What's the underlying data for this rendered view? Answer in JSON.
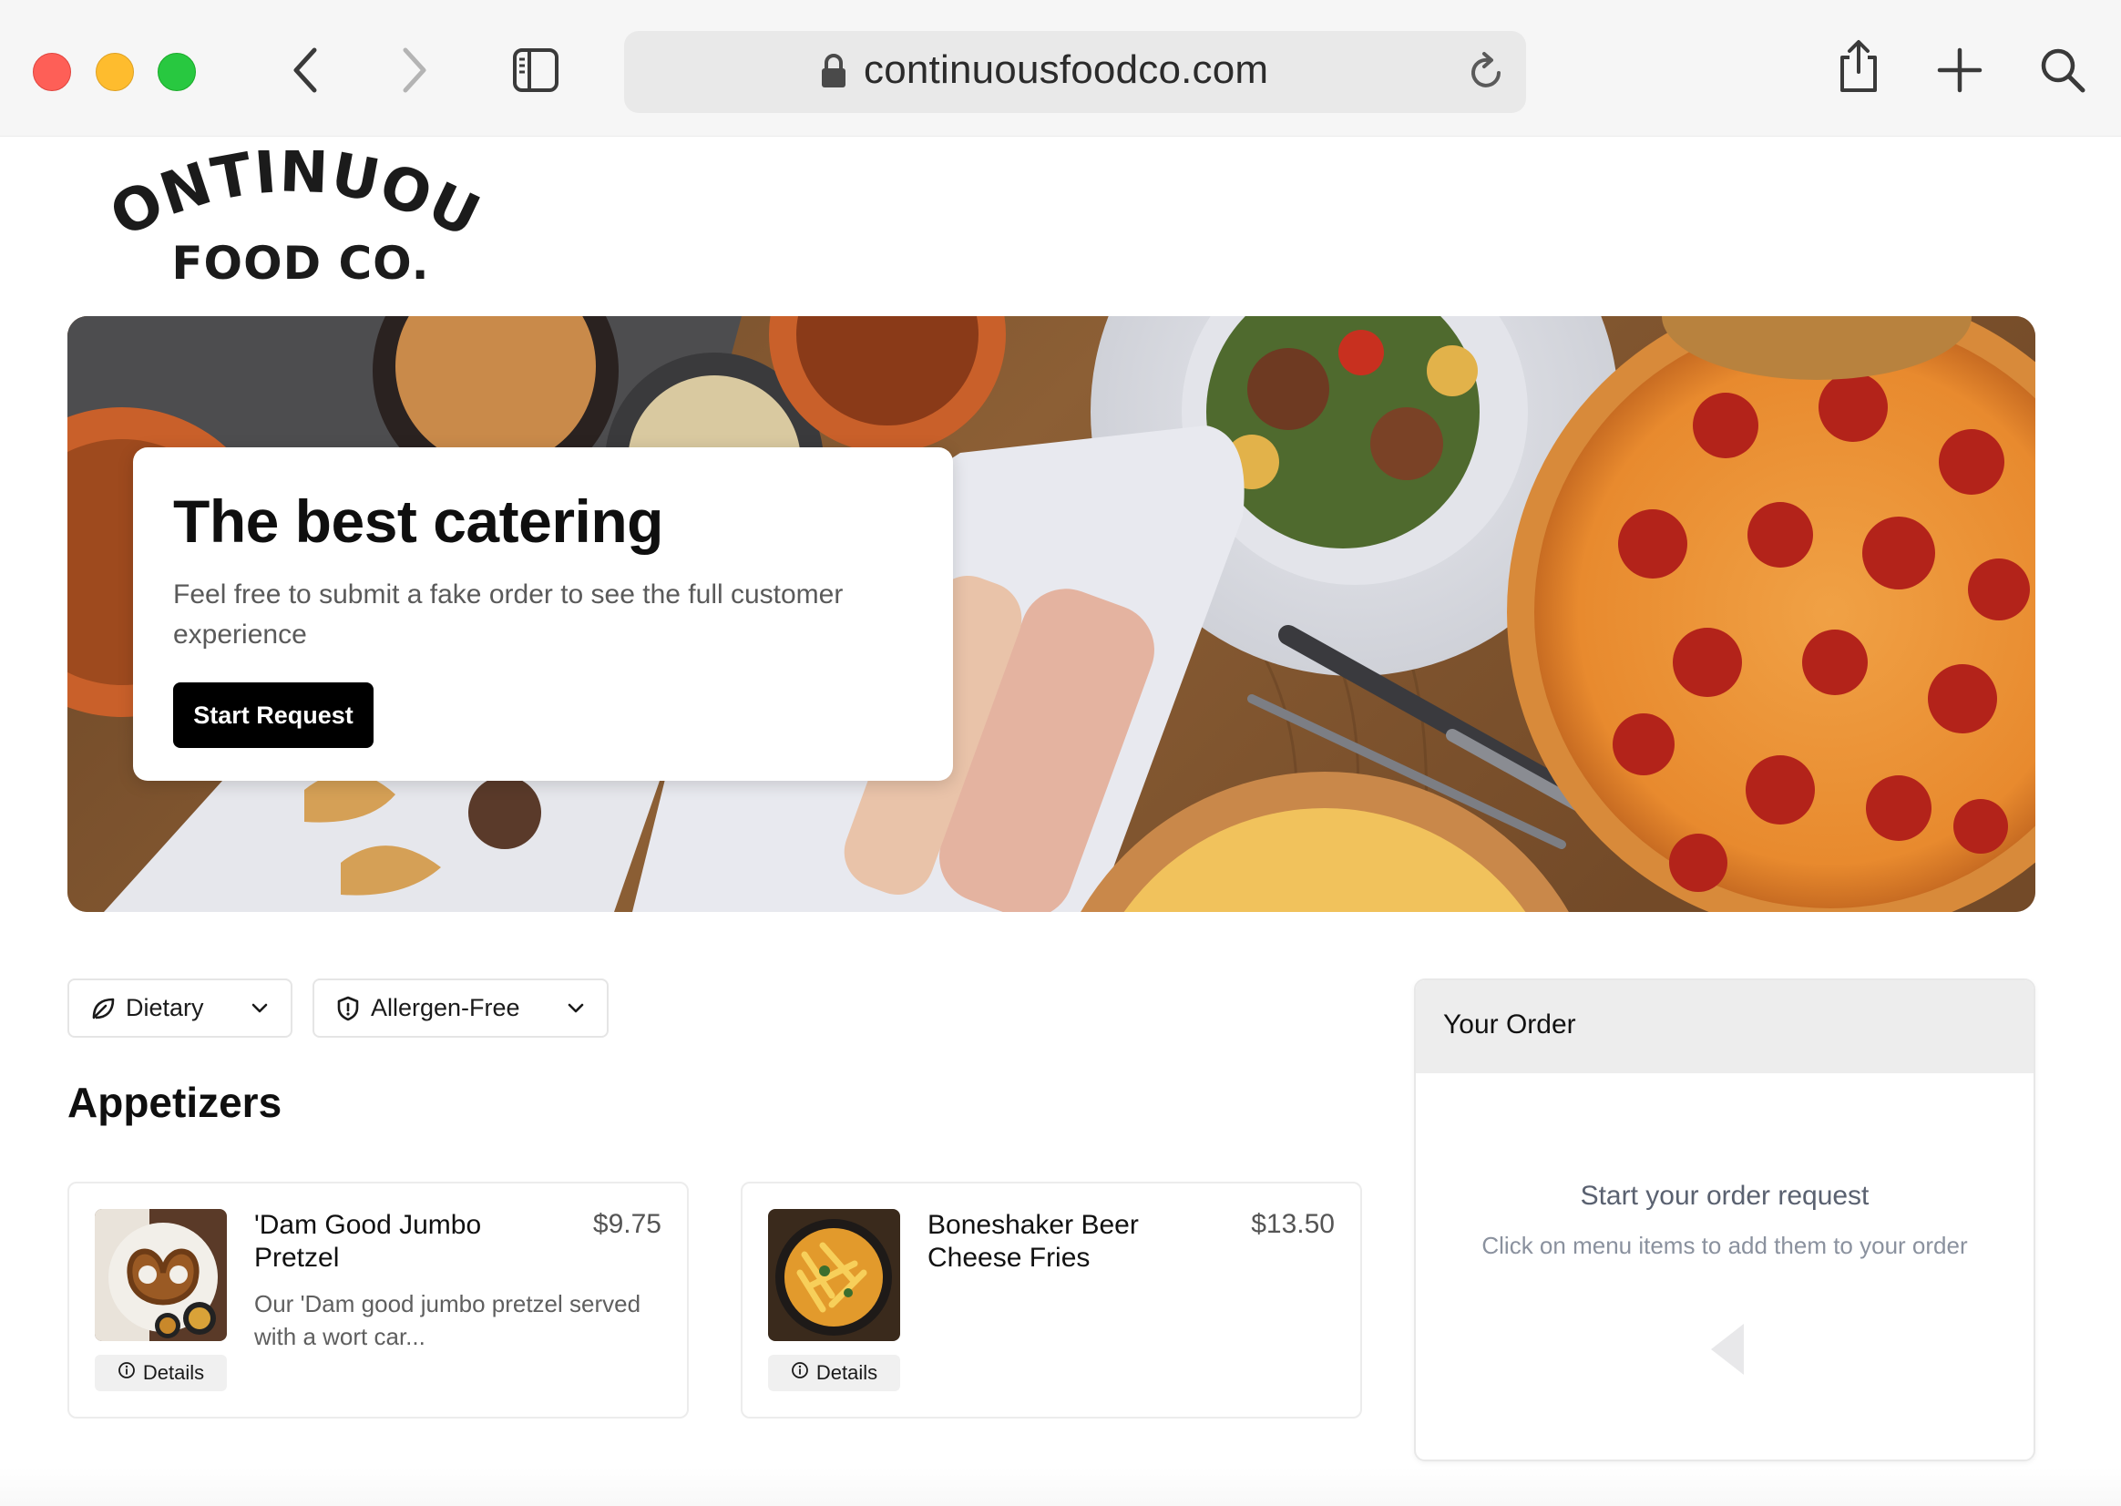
{
  "browser": {
    "url": "continuousfoodco.com",
    "icons": [
      "back-icon",
      "forward-icon",
      "sidebar-icon",
      "lock-icon",
      "reload-icon",
      "share-icon",
      "new-tab-icon",
      "search-icon"
    ]
  },
  "logo": {
    "line1": "CONTINUOUS",
    "line2": "FOOD CO."
  },
  "hero": {
    "title": "The best catering",
    "subtitle": "Feel free to submit a fake order to see the full customer experience",
    "button": "Start Request"
  },
  "filters": [
    {
      "label": "Dietary",
      "icon": "leaf-icon"
    },
    {
      "label": "Allergen-Free",
      "icon": "shield-icon"
    }
  ],
  "section": {
    "title": "Appetizers"
  },
  "items": [
    {
      "name": "'Dam Good Jumbo Pretzel",
      "price": "$9.75",
      "description": "Our 'Dam good jumbo pretzel served with a wort car...",
      "details": "Details"
    },
    {
      "name": "Boneshaker Beer Cheese Fries",
      "price": "$13.50",
      "description": "",
      "details": "Details"
    }
  ],
  "order": {
    "title": "Your Order",
    "empty_title": "Start your order request",
    "empty_sub": "Click on menu items to add them to your order"
  },
  "colors": {
    "accent": "#000000",
    "chrome": "#f6f6f6",
    "muted_text": "#5a6170"
  }
}
